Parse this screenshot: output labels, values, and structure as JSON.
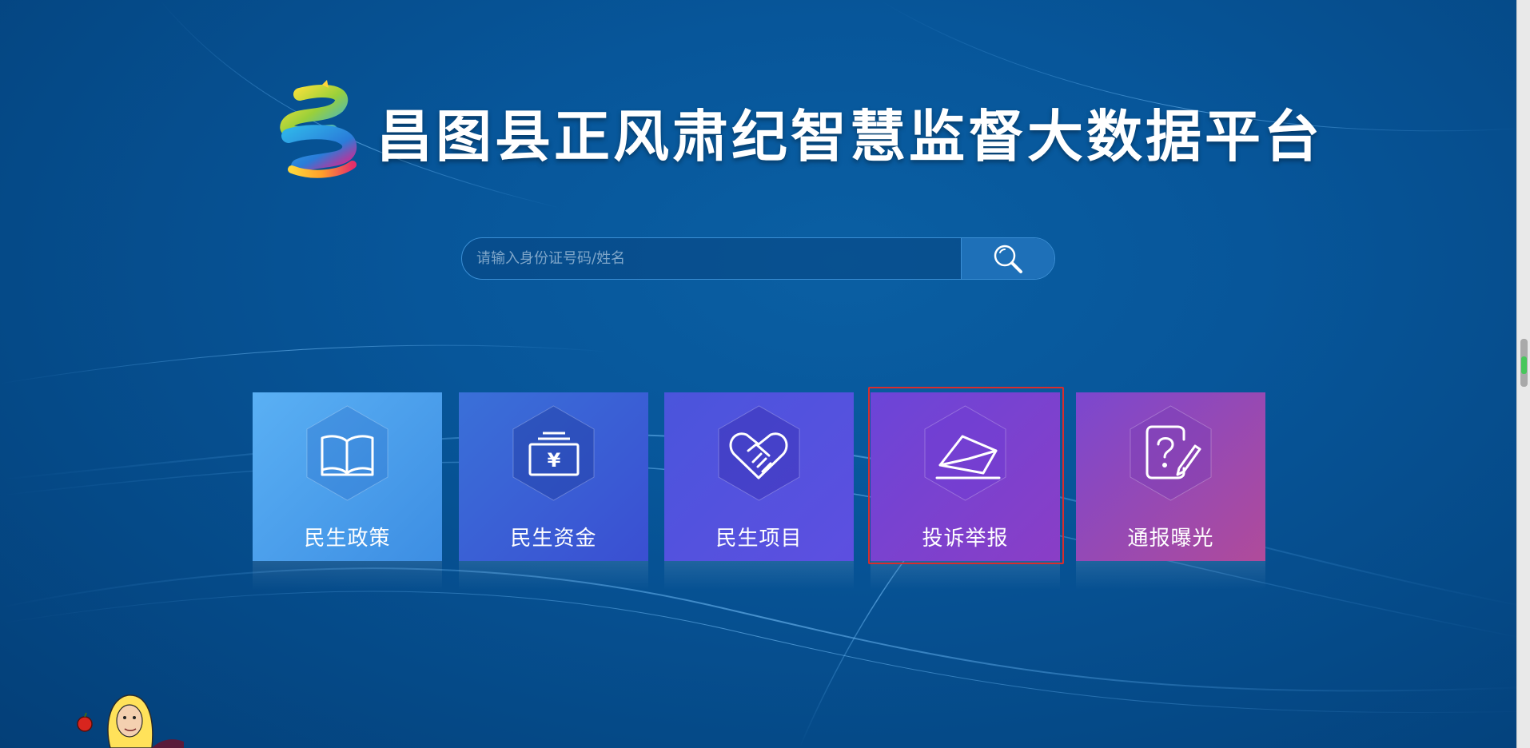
{
  "header": {
    "title": "昌图县正风肃纪智慧监督大数据平台",
    "logo_icon": "swirl-logo-icon"
  },
  "search": {
    "placeholder": "请输入身份证号码/姓名",
    "button_icon": "search-icon"
  },
  "cards": [
    {
      "label": "民生政策",
      "icon": "book-icon",
      "color_from": "#5ab0f4",
      "color_to": "#3d8ee3"
    },
    {
      "label": "民生资金",
      "icon": "money-icon",
      "color_from": "#3a70d8",
      "color_to": "#3a4fd2"
    },
    {
      "label": "民生项目",
      "icon": "handshake-icon",
      "color_from": "#4a55dc",
      "color_to": "#5d4fe0"
    },
    {
      "label": "投诉举报",
      "icon": "envelope-icon",
      "color_from": "#6b45d8",
      "color_to": "#8a3ec6",
      "selected": true
    },
    {
      "label": "通报曝光",
      "icon": "question-pen-icon",
      "color_from": "#7b47cf",
      "color_to": "#b04b9a"
    }
  ],
  "colors": {
    "background": "#054a88",
    "selection_outline": "#d82d2d"
  }
}
